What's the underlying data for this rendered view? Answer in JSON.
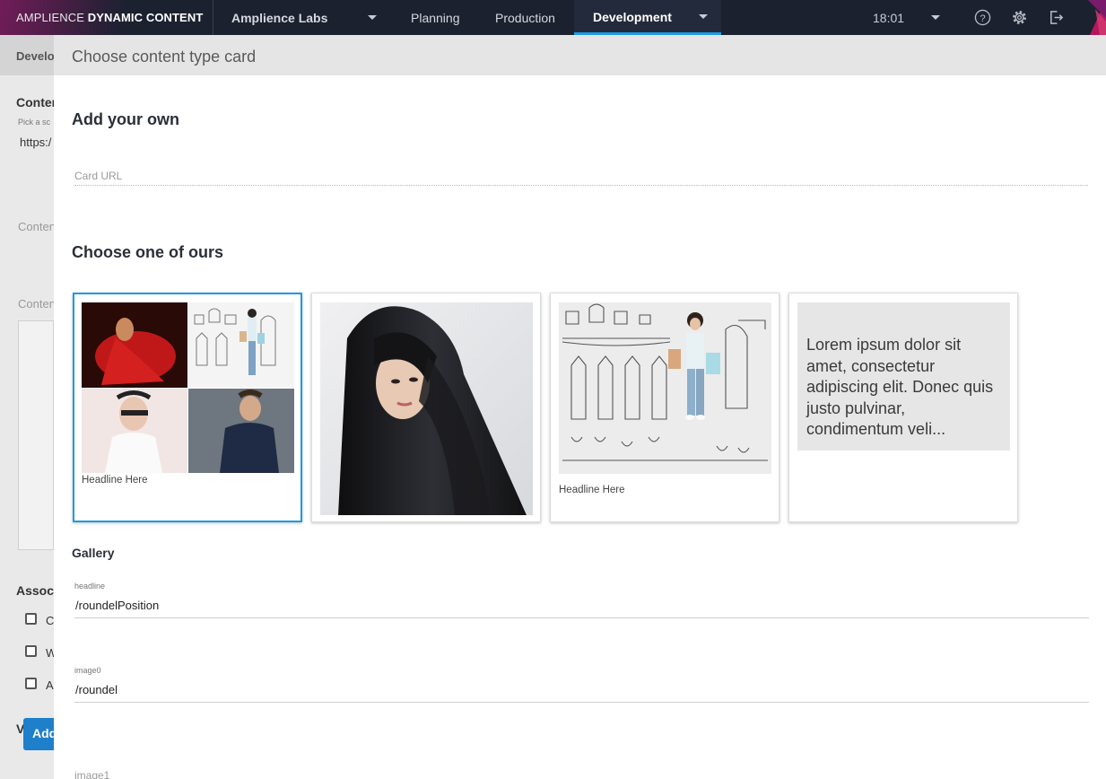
{
  "topbar": {
    "brand_light": "AMPLIENCE",
    "brand_bold": "DYNAMIC CONTENT",
    "hub": "Amplience Labs",
    "tabs": [
      "Planning",
      "Production",
      "Development"
    ],
    "active_tab": "Development",
    "time": "18:01",
    "icons": [
      "help-icon",
      "gear-icon",
      "logout-icon"
    ],
    "accent_color": "#1e9be0"
  },
  "background_page": {
    "breadcrumb": "Develop",
    "content_label": "Conten",
    "pick_hint": "Pick a sc",
    "url_value": "https:/",
    "field2": "Conten",
    "field3": "Conten",
    "associated": "Associ",
    "checkbox_labels": [
      "C",
      "W",
      "A"
    ],
    "visualisation": "Visuali",
    "add_button": "Add"
  },
  "dialog": {
    "title": "Choose content type card",
    "add_own_heading": "Add your own",
    "card_url_placeholder": "Card URL",
    "choose_heading": "Choose one of ours",
    "cards": [
      {
        "name": "gallery",
        "caption": "Headline Here",
        "selected": true
      },
      {
        "name": "photo",
        "caption": "",
        "selected": false
      },
      {
        "name": "banner",
        "caption": "Headline Here",
        "selected": false
      },
      {
        "name": "text",
        "caption": "Lorem ipsum dolor sit amet, consectetur adipiscing elit. Donec quis justo pulvinar, condimentum veli...",
        "selected": false
      }
    ],
    "gallery_heading": "Gallery",
    "fields": [
      {
        "label": "headline",
        "value": "/roundelPosition"
      },
      {
        "label": "image0",
        "value": "/roundel"
      },
      {
        "label": "image1",
        "value": ""
      }
    ]
  }
}
